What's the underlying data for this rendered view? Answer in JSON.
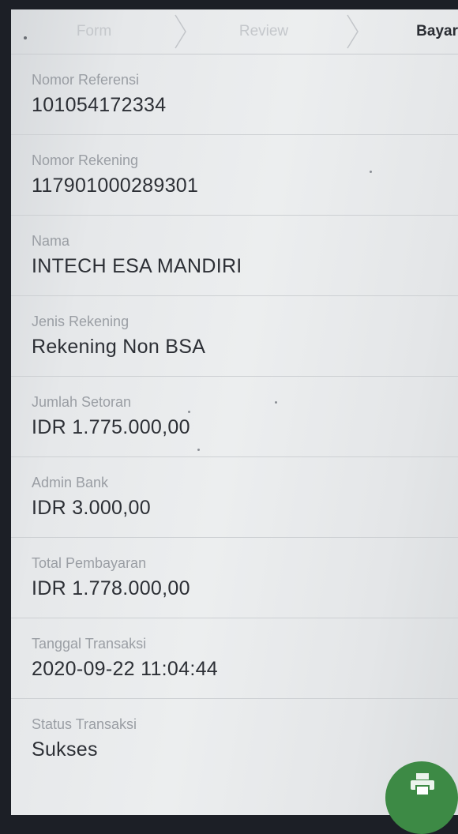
{
  "stepper": {
    "steps": [
      {
        "label": "Form",
        "state": "done"
      },
      {
        "label": "Review",
        "state": "done"
      },
      {
        "label": "Bayar",
        "state": "active"
      }
    ]
  },
  "details": [
    {
      "label": "Nomor Referensi",
      "value": "101054172334"
    },
    {
      "label": "Nomor Rekening",
      "value": "117901000289301"
    },
    {
      "label": "Nama",
      "value": "INTECH ESA MANDIRI"
    },
    {
      "label": "Jenis Rekening",
      "value": "Rekening Non BSA"
    },
    {
      "label": "Jumlah Setoran",
      "value": "IDR 1.775.000,00"
    },
    {
      "label": "Admin Bank",
      "value": "IDR 3.000,00"
    },
    {
      "label": "Total Pembayaran",
      "value": "IDR 1.778.000,00"
    },
    {
      "label": "Tanggal Transaksi",
      "value": "2020-09-22 11:04:44"
    },
    {
      "label": "Status Transaksi",
      "value": "Sukses"
    }
  ],
  "fab": {
    "icon": "print-icon",
    "color": "#3d8a45"
  },
  "colors": {
    "label": "#9a9ea4",
    "value": "#2c2f35",
    "accent": "#3d8a45"
  }
}
